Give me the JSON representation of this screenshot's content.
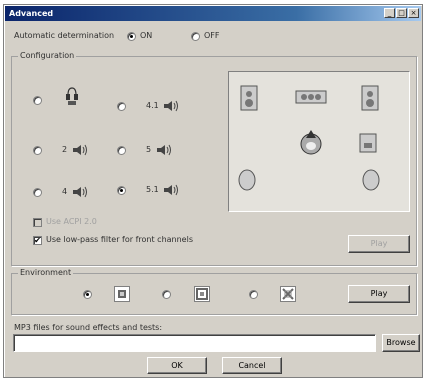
{
  "window": {
    "title": "Advanced",
    "min": "_",
    "max": "□",
    "close": "×"
  },
  "auto_detect": {
    "label": "Automatic determination",
    "on": "ON",
    "off": "OFF",
    "selected": "on"
  },
  "configuration": {
    "title": "Configuration",
    "options": [
      {
        "id": "headphone",
        "label": "",
        "selected": false
      },
      {
        "id": "2",
        "label": "2",
        "selected": false
      },
      {
        "id": "4",
        "label": "4",
        "selected": false
      },
      {
        "id": "4.1",
        "label": "4.1",
        "selected": false
      },
      {
        "id": "5",
        "label": "5",
        "selected": false
      },
      {
        "id": "5.1",
        "label": "5.1",
        "selected": true
      }
    ],
    "check_disabled_label": "Use ACPI 2.0",
    "check_enabled_label": "Use low-pass filter for front channels",
    "play_label": "Play"
  },
  "environment": {
    "title": "Environment",
    "play_label": "Play",
    "selected_index": 0
  },
  "mp3": {
    "label": "MP3 files for sound effects and tests:",
    "value": "",
    "browse_label": "Browse"
  },
  "footer": {
    "ok_label": "OK",
    "cancel_label": "Cancel"
  },
  "colors": {
    "title_start": "#0a246a",
    "title_end": "#a6caf0",
    "face": "#d4d0c8"
  }
}
